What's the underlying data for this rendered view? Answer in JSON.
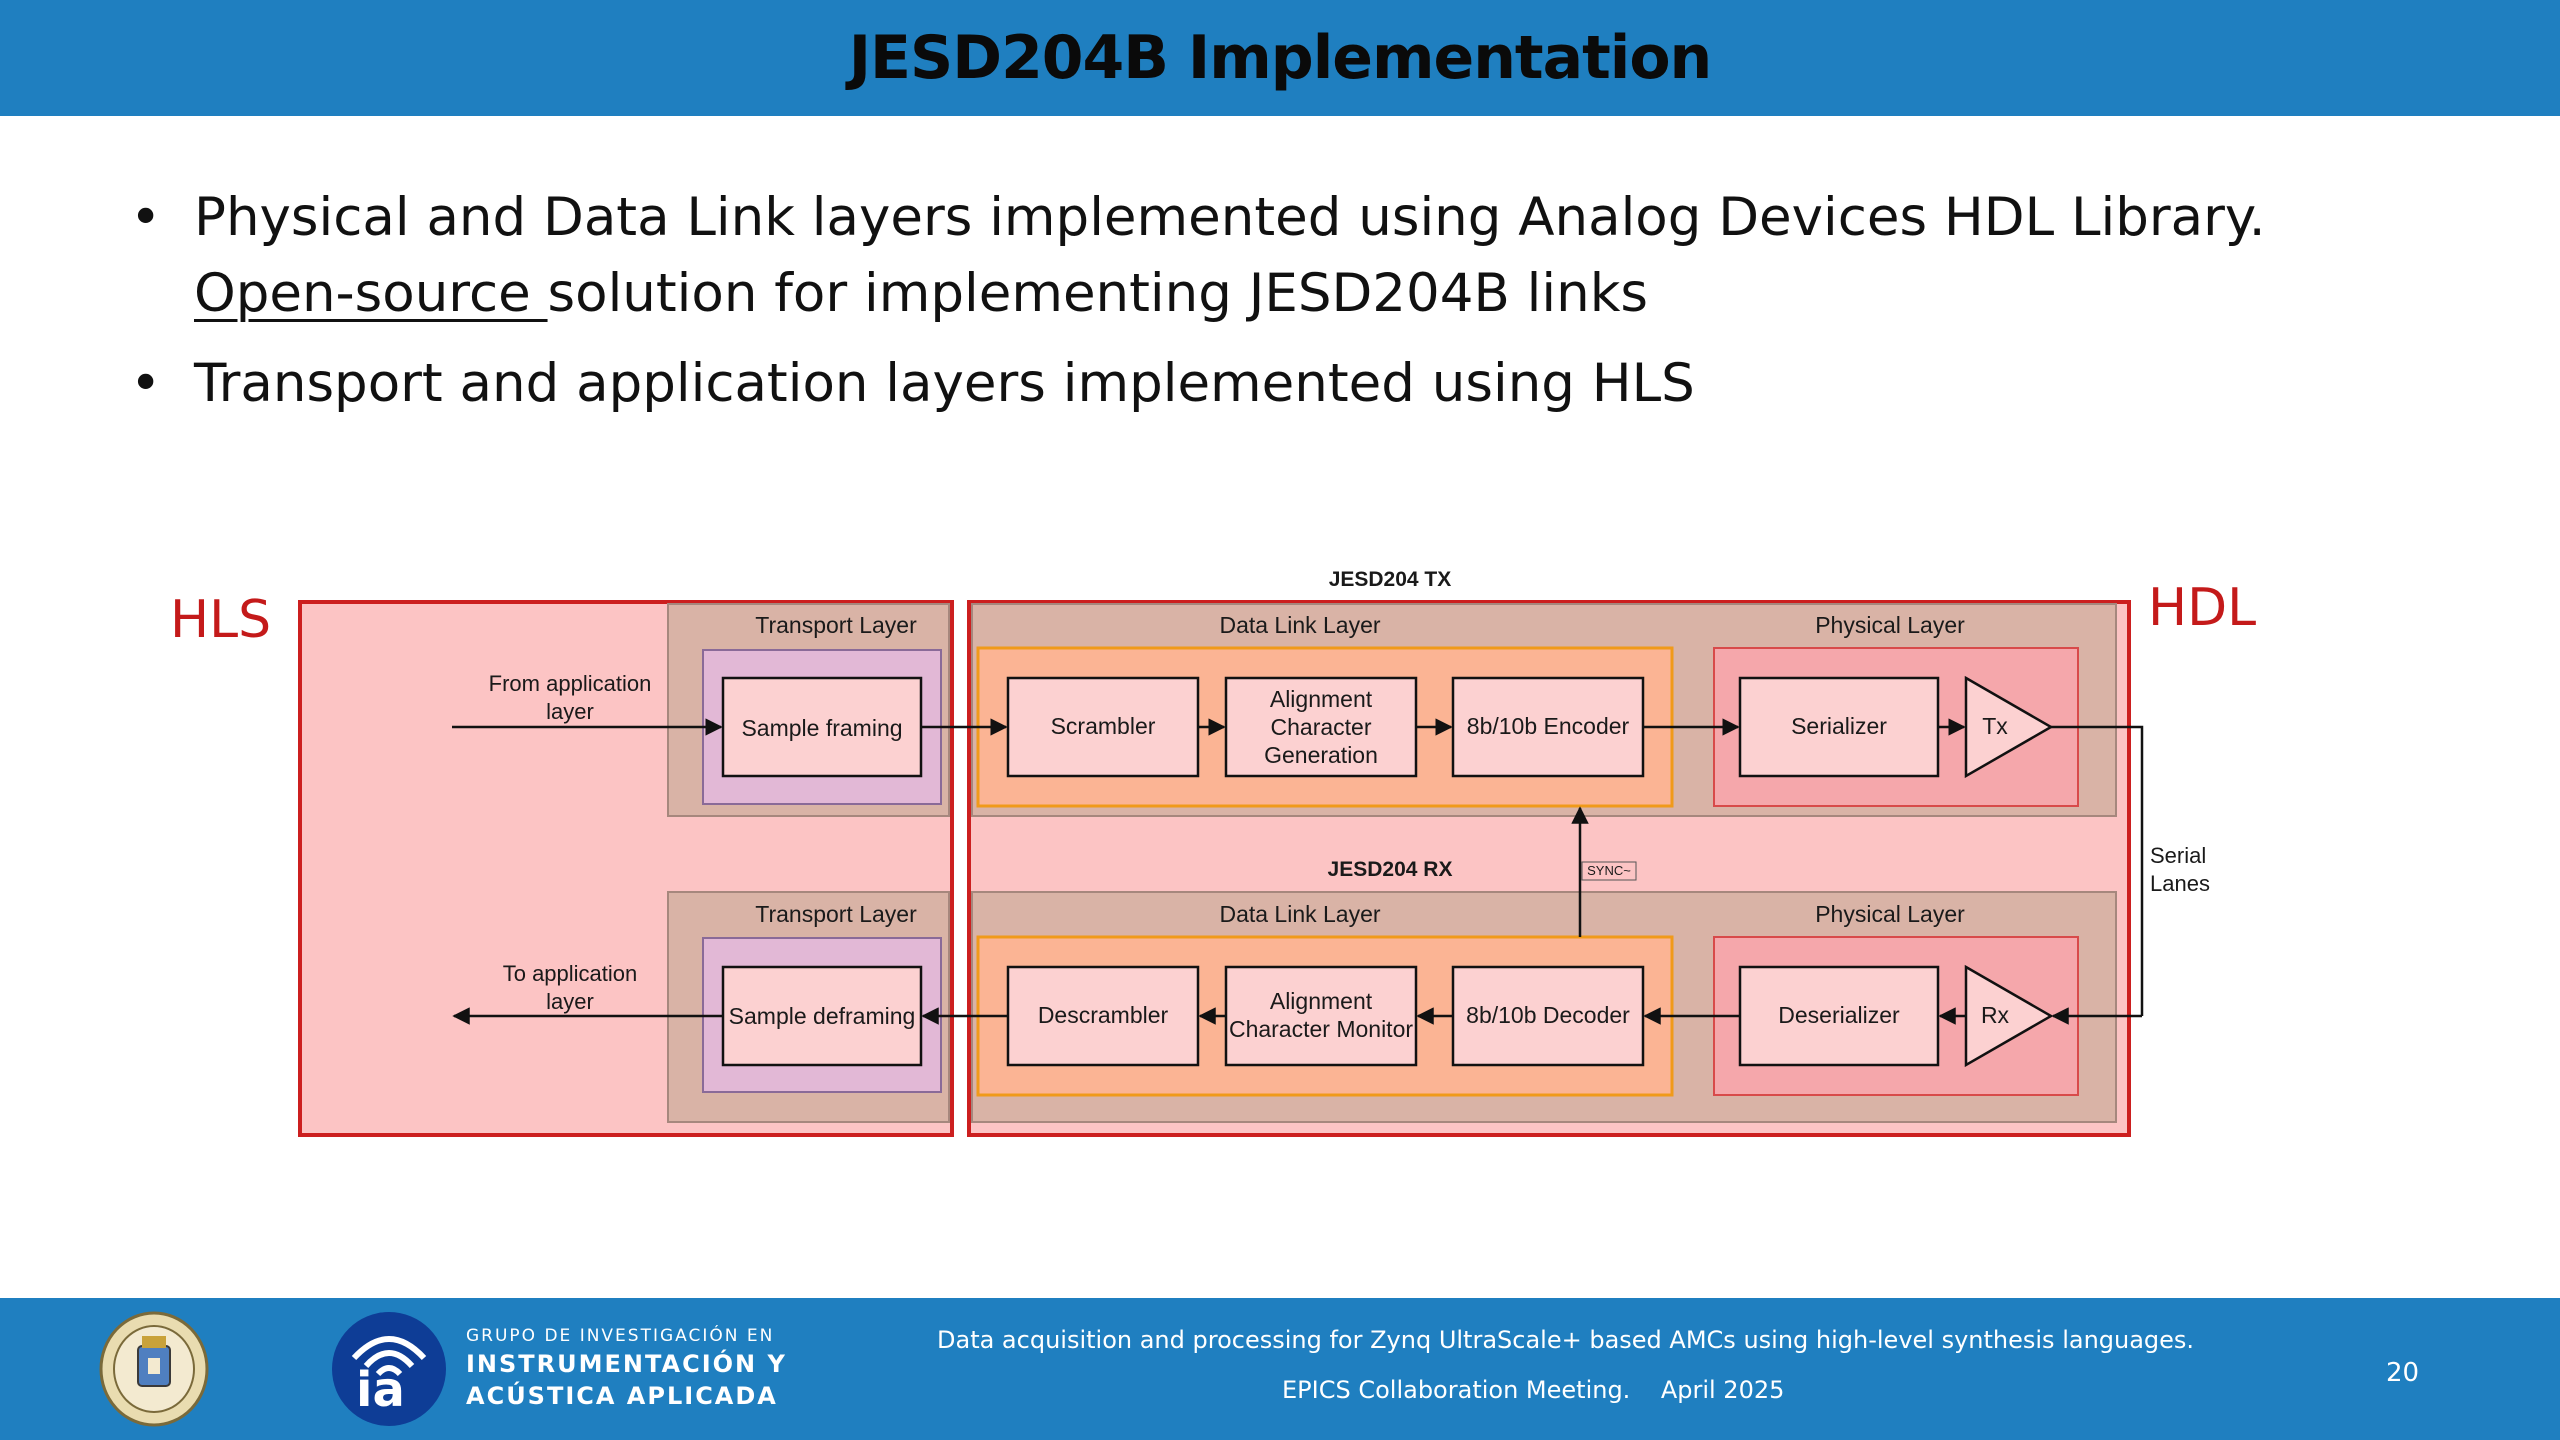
{
  "slide": {
    "title": "JESD204B Implementation",
    "page_number": "20"
  },
  "bullets": {
    "b1_part1": "Physical and Data Link layers implemented using Analog Devices HDL Library.",
    "b1_link": " Open-source ",
    "b1_part2": "solution for implementing JESD204B links",
    "b2": "Transport and application layers implemented using HLS"
  },
  "diagram": {
    "hls_label": "HLS",
    "hdl_label": "HDL",
    "tx_title": "JESD204 TX",
    "rx_title": "JESD204 RX",
    "tx": {
      "transport_layer": "Transport Layer",
      "data_link_layer": "Data Link Layer",
      "physical_layer": "Physical Layer",
      "from_app": [
        "From application",
        "layer"
      ],
      "sample_framing": "Sample framing",
      "scrambler": "Scrambler",
      "alignment": [
        "Alignment",
        "Character",
        "Generation"
      ],
      "encoder": "8b/10b Encoder",
      "serializer": "Serializer",
      "tx": "Tx"
    },
    "rx": {
      "transport_layer": "Transport Layer",
      "data_link_layer": "Data Link Layer",
      "physical_layer": "Physical Layer",
      "to_app": [
        "To application",
        "layer"
      ],
      "sample_deframing": "Sample deframing",
      "descrambler": "Descrambler",
      "alignment": [
        "Alignment",
        "Character Monitor"
      ],
      "decoder": "8b/10b Decoder",
      "deserializer": "Deserializer",
      "rx": "Rx"
    },
    "sync": "SYNC~",
    "serial_lanes": [
      "Serial",
      "Lanes"
    ]
  },
  "footer": {
    "group_line1": "GRUPO DE INVESTIGACIÓN EN",
    "group_line2": "INSTRUMENTACIÓN Y",
    "group_line3": "ACÚSTICA APLICADA",
    "ia_mark": "ia",
    "talk_title": "Data acquisition and processing for Zynq UltraScale+ based AMCs using high-level synthesis languages.",
    "event": "EPICS Collaboration Meeting.    April 2025"
  },
  "colors": {
    "header": "#1f7fc0",
    "hls_red": "#c41a1a",
    "region_pink": "#fcc4c4",
    "layer_tan": "#d9b3a6",
    "purple": "#e2b8d6",
    "orange": "#fbb494",
    "physical_pink": "#f5a7ab"
  }
}
